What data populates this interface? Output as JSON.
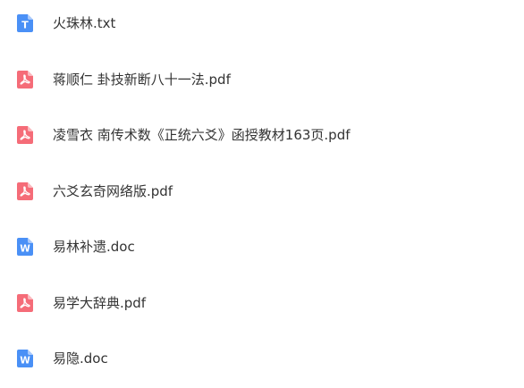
{
  "colors": {
    "txt_icon": "#4a90f6",
    "pdf_icon": "#f56c78",
    "doc_icon": "#4a90f6",
    "text": "#333333"
  },
  "files": [
    {
      "name": "火珠林.txt",
      "type": "txt",
      "icon": "txt-file-icon",
      "glyph": "T"
    },
    {
      "name": "蒋顺仁 卦技新断八十一法.pdf",
      "type": "pdf",
      "icon": "pdf-file-icon",
      "glyph": ""
    },
    {
      "name": "凌雪衣 南传术数《正统六爻》函授教材163页.pdf",
      "type": "pdf",
      "icon": "pdf-file-icon",
      "glyph": ""
    },
    {
      "name": "六爻玄奇网络版.pdf",
      "type": "pdf",
      "icon": "pdf-file-icon",
      "glyph": ""
    },
    {
      "name": "易林补遗.doc",
      "type": "doc",
      "icon": "word-file-icon",
      "glyph": "W"
    },
    {
      "name": "易学大辞典.pdf",
      "type": "pdf",
      "icon": "pdf-file-icon",
      "glyph": ""
    },
    {
      "name": "易隐.doc",
      "type": "doc",
      "icon": "word-file-icon",
      "glyph": "W"
    }
  ]
}
